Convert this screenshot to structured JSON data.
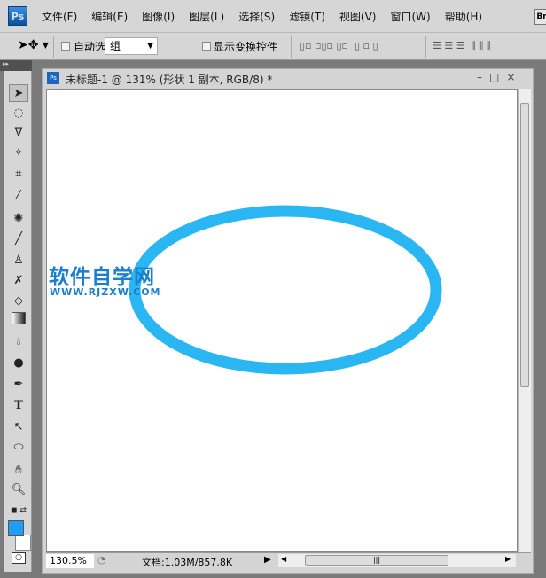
{
  "menubar": {
    "logo": "Ps",
    "items": [
      "文件(F)",
      "编辑(E)",
      "图像(I)",
      "图层(L)",
      "选择(S)",
      "滤镜(T)",
      "视图(V)",
      "窗口(W)",
      "帮助(H)"
    ],
    "bridge": "Br"
  },
  "options": {
    "auto_select_label": "自动选择:",
    "auto_select_value": "组",
    "show_transform_label": "显示变换控件"
  },
  "document": {
    "logo": "Ps",
    "title": "未标题-1 @ 131% (形状 1 副本, RGB/8) *",
    "zoom": "130.5%",
    "doc_info": "文档:1.03M/857.8K"
  },
  "watermark": {
    "title": "软件自学网",
    "url": "WWW.RJZXW.COM"
  },
  "colors": {
    "foreground": "#1f9ef5",
    "ellipse": "#29b6f2",
    "watermark": "#1a7fd0"
  }
}
